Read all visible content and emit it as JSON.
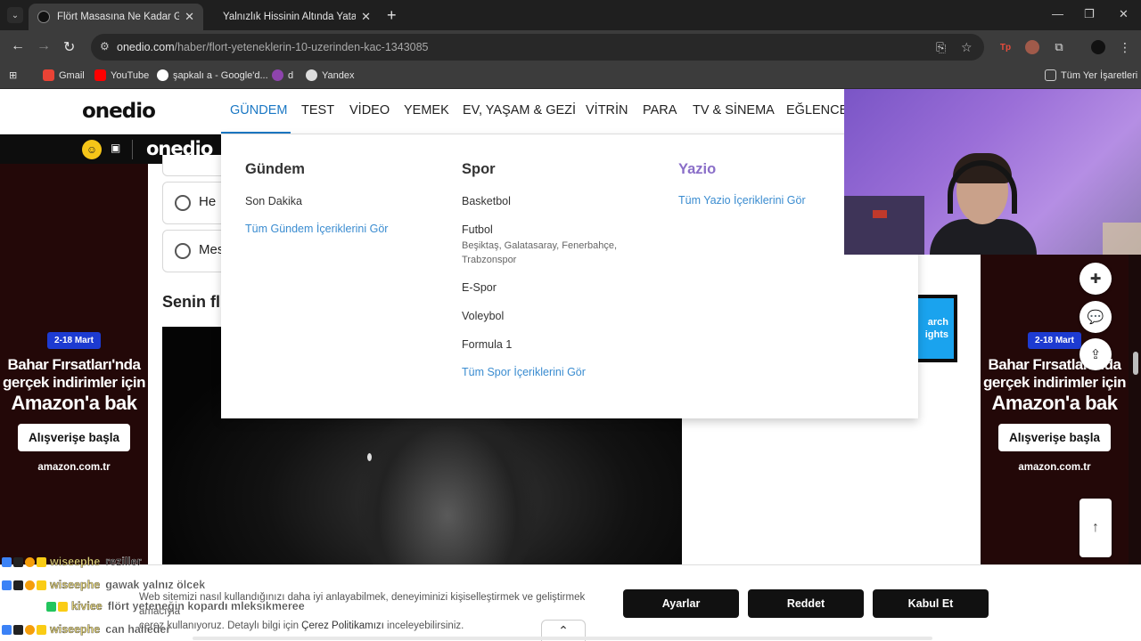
{
  "browser": {
    "tabs": [
      {
        "title": "Flört Masasına Ne Kadar Güçlü",
        "active": true
      },
      {
        "title": "Yalnızlık Hissinin Altında Yatan (",
        "active": false
      }
    ],
    "address": {
      "host": "onedio.com",
      "path": "/haber/flort-yeteneklerin-10-uzerinden-kac-1343085"
    },
    "bookmarks": [
      {
        "label": "Gmail",
        "icon": "gmail-icon",
        "color": "#ea4335"
      },
      {
        "label": "YouTube",
        "icon": "youtube-icon",
        "color": "#ff0000"
      },
      {
        "label": "şapkalı a - Google'd...",
        "icon": "google-icon",
        "color": "#4285f4"
      },
      {
        "label": "d",
        "icon": "custom-icon",
        "color": "#8e44ad"
      },
      {
        "label": "Yandex",
        "icon": "yandex-icon",
        "color": "#dddddd"
      }
    ],
    "all_bookmarks": "Tüm Yer İşaretleri"
  },
  "site": {
    "logo": "onedio",
    "nav": [
      "GÜNDEM",
      "TEST",
      "VİDEO",
      "YEMEK",
      "EV, YAŞAM & GEZİ",
      "VİTRİN",
      "PARA",
      "TV & SİNEMA",
      "EĞLENCE"
    ],
    "sub_logo": "onedio"
  },
  "megamenu": {
    "gundem": {
      "title": "Gündem",
      "items": [
        "Son Dakika"
      ],
      "all": "Tüm Gündem İçeriklerini Gör"
    },
    "spor": {
      "title": "Spor",
      "items": [
        "Basketbol",
        "Futbol",
        "E-Spor",
        "Voleybol",
        "Formula 1"
      ],
      "futbol_sub": "Beşiktaş, Galatasaray, Fenerbahçe, Trabzonspor",
      "all": "Tüm Spor İçeriklerini Gör"
    },
    "yazio": {
      "title": "Yazio",
      "all": "Tüm Yazio İçeriklerini Gör"
    }
  },
  "article": {
    "options": [
      "He",
      "Mes"
    ],
    "question_title": "Senin fl",
    "promo_text": [
      "arch",
      "ights"
    ]
  },
  "ads": {
    "date": "2-18 Mart",
    "headline": [
      "Bahar Fırsatları'nda",
      "gerçek indirimler için",
      "Amazon'a bak"
    ],
    "cta": "Alışverişe başla",
    "brand": "amazon.com.tr"
  },
  "cookie": {
    "line1": "Web sitemizi nasıl kullandığınızı daha iyi anlayabilmek, deneyiminizi kişiselleştirmek ve geliştirmek amacıyla",
    "line2_pre": "çerez kullanıyoruz. Detaylı bilgi için ",
    "policy": "Çerez Politikamızı",
    "line2_post": " inceleyebilirsiniz.",
    "buttons": [
      "Ayarlar",
      "Reddet",
      "Kabul Et"
    ]
  },
  "chat": [
    {
      "user": "wiseephe",
      "msg": "reziller"
    },
    {
      "user": "wiseephe",
      "msg": "gawak yalnız ölcek"
    },
    {
      "user": "kiviee",
      "msg": "flört yeteneğin kopardı mleksıkmeree"
    },
    {
      "user": "wiseephe",
      "msg": "can halleder"
    }
  ],
  "colors": {
    "accent": "#1b78c4",
    "yazio": "#8a6ec8",
    "ad_bg": "#230808",
    "amazon_blue": "#1d3bd1"
  }
}
